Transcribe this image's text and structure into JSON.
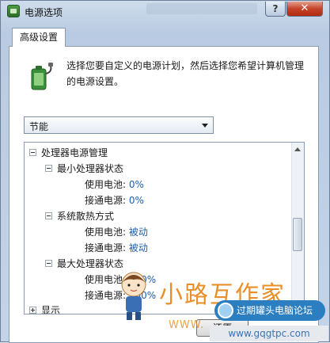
{
  "window": {
    "title": "电源选项",
    "help_label": "?",
    "close_label": "✕"
  },
  "tabs": [
    {
      "label": "高级设置"
    }
  ],
  "intro_text": "选择您要自定义的电源计划，然后选择您希望计算机管理的电源设置。",
  "plan_select": {
    "value": "节能"
  },
  "tree": {
    "processor_group": "处理器电源管理",
    "min_state": {
      "label": "最小处理器状态",
      "battery_label": "使用电池:",
      "battery_value": "0%",
      "ac_label": "接通电源:",
      "ac_value": "0%"
    },
    "cooling": {
      "label": "系统散热方式",
      "battery_label": "使用电池:",
      "battery_value": "被动",
      "ac_label": "接通电源:",
      "ac_value": "被动"
    },
    "max_state": {
      "label": "最大处理器状态",
      "battery_label": "使用电池:",
      "battery_value": "100%",
      "ac_label": "接通电源:",
      "ac_value": "100%"
    },
    "display_group": "显示"
  },
  "buttons": {
    "restore_label": "还原"
  },
  "watermark": {
    "brand": "小路互作家",
    "badge": "过期罐头电脑论坛",
    "url": "www.gqgtpc.com",
    "www": "WWW."
  },
  "colors": {
    "value_link": "#1f5fa8",
    "close_button": "#c6432a",
    "watermark_orange": "#e88a1e"
  }
}
